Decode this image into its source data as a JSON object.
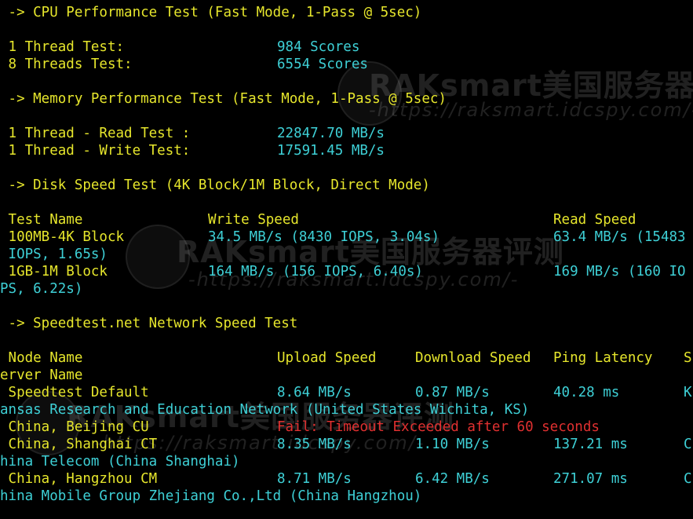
{
  "colors": {
    "background": "#000000",
    "yellow": "#e6e62c",
    "cyan": "#3ed0d6",
    "red": "#e03030"
  },
  "watermark": {
    "title": "RAKsmart美国服务器评测",
    "url": "-https://raksmart.idcspy.com/-"
  },
  "cpu": {
    "header": " -> CPU Performance Test (Fast Mode, 1-Pass @ 5sec)",
    "rows": [
      {
        "label": " 1 Thread Test:",
        "value": "984 Scores"
      },
      {
        "label": " 8 Threads Test:",
        "value": "6554 Scores"
      }
    ]
  },
  "memory": {
    "header": " -> Memory Performance Test (Fast Mode, 1-Pass @ 5sec)",
    "rows": [
      {
        "label": " 1 Thread - Read Test :",
        "value": "22847.70 MB/s"
      },
      {
        "label": " 1 Thread - Write Test:",
        "value": "17591.45 MB/s"
      }
    ]
  },
  "disk": {
    "header": " -> Disk Speed Test (4K Block/1M Block, Direct Mode)",
    "columns": {
      "name": " Test Name",
      "write": "Write Speed",
      "read": "Read Speed"
    },
    "rows": [
      {
        "name": " 100MB-4K Block",
        "write": "34.5 MB/s (8430 IOPS, 3.04s)",
        "read": "63.4 MB/s (15483",
        "wrap": " IOPS, 1.65s)"
      },
      {
        "name": " 1GB-1M Block",
        "write": "164 MB/s (156 IOPS, 6.40s)",
        "read": "169 MB/s (160 IO",
        "wrap": "PS, 6.22s)"
      }
    ]
  },
  "network": {
    "header": " -> Speedtest.net Network Speed Test",
    "columns": {
      "node": " Node Name",
      "upload": "Upload Speed",
      "download": "Download Speed",
      "ping": "Ping Latency",
      "server_head": "S",
      "server_wrap": "erver Name"
    },
    "rows": [
      {
        "node": " Speedtest Default",
        "upload": "8.64 MB/s",
        "download": "0.87 MB/s",
        "ping": "40.28 ms",
        "server_head": "K",
        "server_wrap": "ansas Research and Education Network (United States Wichita, KS)"
      },
      {
        "node": " China, Beijing CU",
        "error": "Fail: Timeout Exceeded after 60 seconds"
      },
      {
        "node": " China, Shanghai CT",
        "upload": "8.35 MB/s",
        "download": "1.10 MB/s",
        "ping": "137.21 ms",
        "server_head": "C",
        "server_wrap": "hina Telecom (China Shanghai)"
      },
      {
        "node": " China, Hangzhou CM",
        "upload": "8.71 MB/s",
        "download": "6.42 MB/s",
        "ping": "271.07 ms",
        "server_head": "C",
        "server_wrap": "hina Mobile Group Zhejiang Co.,Ltd (China Hangzhou)"
      }
    ]
  }
}
